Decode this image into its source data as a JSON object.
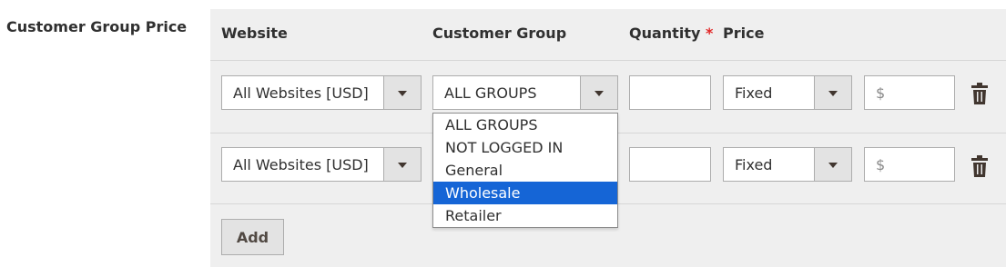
{
  "field_label": "Customer Group Price",
  "columns": {
    "website": "Website",
    "customer_group": "Customer Group",
    "quantity": "Quantity",
    "required_mark": "*",
    "price": "Price"
  },
  "rows": [
    {
      "website": "All Websites [USD]",
      "customer_group": "ALL GROUPS",
      "quantity": "",
      "price_type": "Fixed",
      "price_placeholder": "$"
    },
    {
      "website": "All Websites [USD]",
      "quantity": "",
      "price_type": "Fixed",
      "price_placeholder": "$"
    }
  ],
  "customer_group_dropdown": {
    "options": [
      "ALL GROUPS",
      "NOT LOGGED IN",
      "General",
      "Wholesale",
      "Retailer"
    ],
    "highlighted": "Wholesale"
  },
  "add_button": "Add",
  "icons": {
    "select_arrow": "chevron-down-icon",
    "delete": "trash-icon"
  },
  "colors": {
    "highlight": "#1565d6",
    "required": "#e22626",
    "panel_bg": "#efefef"
  }
}
